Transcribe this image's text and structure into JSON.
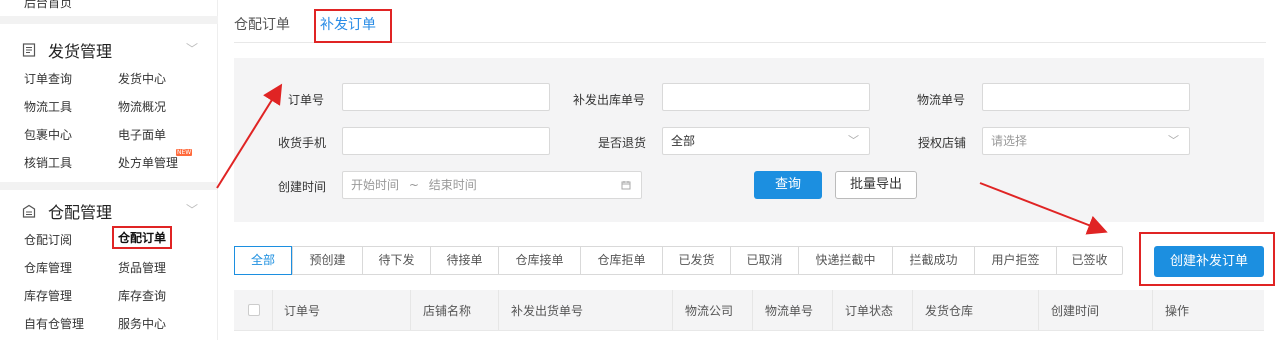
{
  "sidebar": {
    "home": "后台首页",
    "sections": [
      {
        "title": "发货管理",
        "items": [
          "订单查询",
          "发货中心",
          "物流工具",
          "物流概况",
          "包裹中心",
          "电子面单",
          "核销工具",
          "处方单管理"
        ],
        "new_badge": "NEW"
      },
      {
        "title": "仓配管理",
        "items": [
          "仓配订阅",
          "仓配订单",
          "仓库管理",
          "货品管理",
          "库存管理",
          "库存查询",
          "自有仓管理",
          "服务中心"
        ]
      }
    ]
  },
  "tabs": [
    "仓配订单",
    "补发订单"
  ],
  "filter": {
    "order_no": "订单号",
    "reissue_out_no": "补发出库单号",
    "logistics_no": "物流单号",
    "phone": "收货手机",
    "is_return": "是否退货",
    "is_return_value": "全部",
    "auth_store": "授权店铺",
    "auth_store_placeholder": "请选择",
    "created": "创建时间",
    "start_placeholder": "开始时间",
    "range_sep": "~",
    "end_placeholder": "结束时间",
    "calendar_icon": "calendar-icon",
    "query": "查询",
    "export": "批量导出"
  },
  "status_tabs": [
    "全部",
    "预创建",
    "待下发",
    "待接单",
    "仓库接单",
    "仓库拒单",
    "已发货",
    "已取消",
    "快递拦截中",
    "拦截成功",
    "用户拒签",
    "已签收"
  ],
  "create_button": "创建补发订单",
  "table_headers": [
    "订单号",
    "店铺名称",
    "补发出货单号",
    "物流公司",
    "物流单号",
    "订单状态",
    "发货仓库",
    "创建时间",
    "操作"
  ],
  "colors": {
    "accent": "#1c8fe0",
    "highlight": "#e02424"
  }
}
